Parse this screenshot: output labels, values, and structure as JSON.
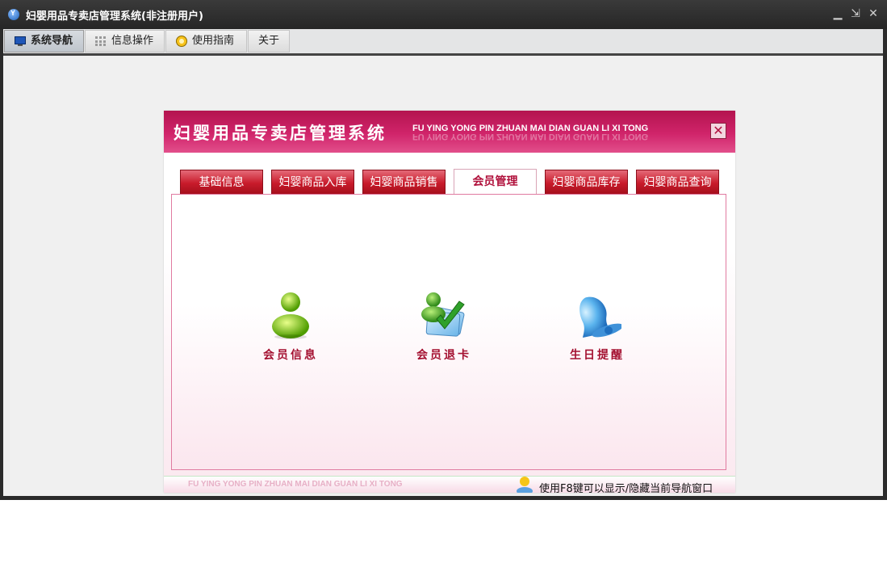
{
  "window": {
    "title": "妇婴用品专卖店管理系统(非注册用户)",
    "logo_letter": "Y",
    "controls": {
      "minimize": "▁",
      "restore": "⇲",
      "close": "✕"
    }
  },
  "menubar": {
    "tabs": [
      {
        "label": "系统导航",
        "icon": "monitor-icon",
        "active": true
      },
      {
        "label": "信息操作",
        "icon": "grid-icon",
        "active": false
      },
      {
        "label": "使用指南",
        "icon": "guide-icon",
        "active": false
      },
      {
        "label": "关于",
        "icon": "",
        "active": false
      }
    ]
  },
  "panel": {
    "title": "妇婴用品专卖店管理系统",
    "subtitle": "FU YING YONG PIN ZHUAN MAI DIAN GUAN LI XI TONG",
    "close_label": "✕",
    "tabs": [
      {
        "label": "基础信息",
        "selected": false
      },
      {
        "label": "妇婴商品入库",
        "selected": false
      },
      {
        "label": "妇婴商品销售",
        "selected": false
      },
      {
        "label": "会员管理",
        "selected": true
      },
      {
        "label": "妇婴商品库存",
        "selected": false
      },
      {
        "label": "妇婴商品查询",
        "selected": false
      }
    ],
    "items": [
      {
        "label": "会员信息",
        "icon": "member-info-icon"
      },
      {
        "label": "会员退卡",
        "icon": "member-refund-icon"
      },
      {
        "label": "生日提醒",
        "icon": "bell-icon"
      }
    ],
    "footer": {
      "subtitle": "FU YING YONG PIN ZHUAN MAI DIAN GUAN LI XI TONG",
      "tip": "使用F8键可以显示/隐藏当前导航窗口"
    }
  },
  "colors": {
    "header_pink": "#d0246a",
    "tab_red": "#c81b2b",
    "label_red": "#a41030",
    "window_dark": "#2b2b2b"
  }
}
